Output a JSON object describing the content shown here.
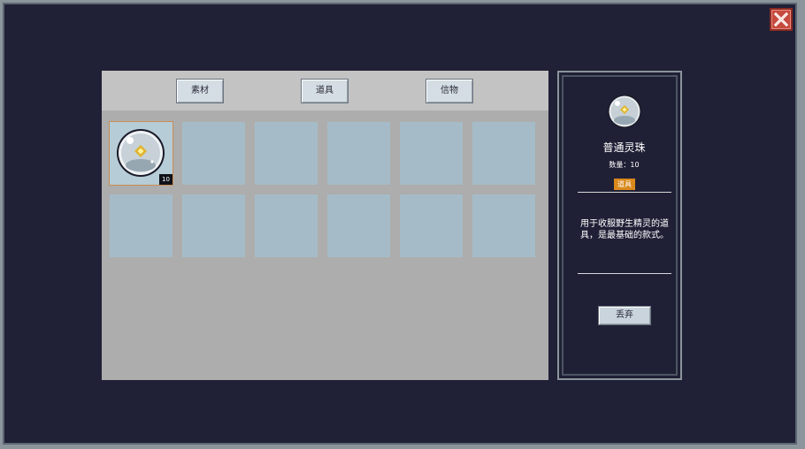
{
  "tabs": [
    {
      "label": "素材"
    },
    {
      "label": "道具"
    },
    {
      "label": "信物"
    }
  ],
  "slots": [
    {
      "item": "spirit-orb",
      "count": "10",
      "selected": true
    },
    {
      "item": null
    },
    {
      "item": null
    },
    {
      "item": null
    },
    {
      "item": null
    },
    {
      "item": null
    },
    {
      "item": null
    },
    {
      "item": null
    },
    {
      "item": null
    },
    {
      "item": null
    },
    {
      "item": null
    },
    {
      "item": null
    }
  ],
  "detail": {
    "name": "普通灵珠",
    "quantity": "数量：10",
    "type": "道具",
    "description": "用于收服野生精灵的道具，是最基础的款式。",
    "discard_label": "丢弃"
  },
  "colors": {
    "background": "#202037",
    "panel": "#adadad",
    "slot": "#a5bcc8",
    "type_badge": "#d9881c",
    "close": "#c74a3f"
  },
  "icons": {
    "close": "close-x-icon",
    "item": "spirit-orb-icon"
  }
}
